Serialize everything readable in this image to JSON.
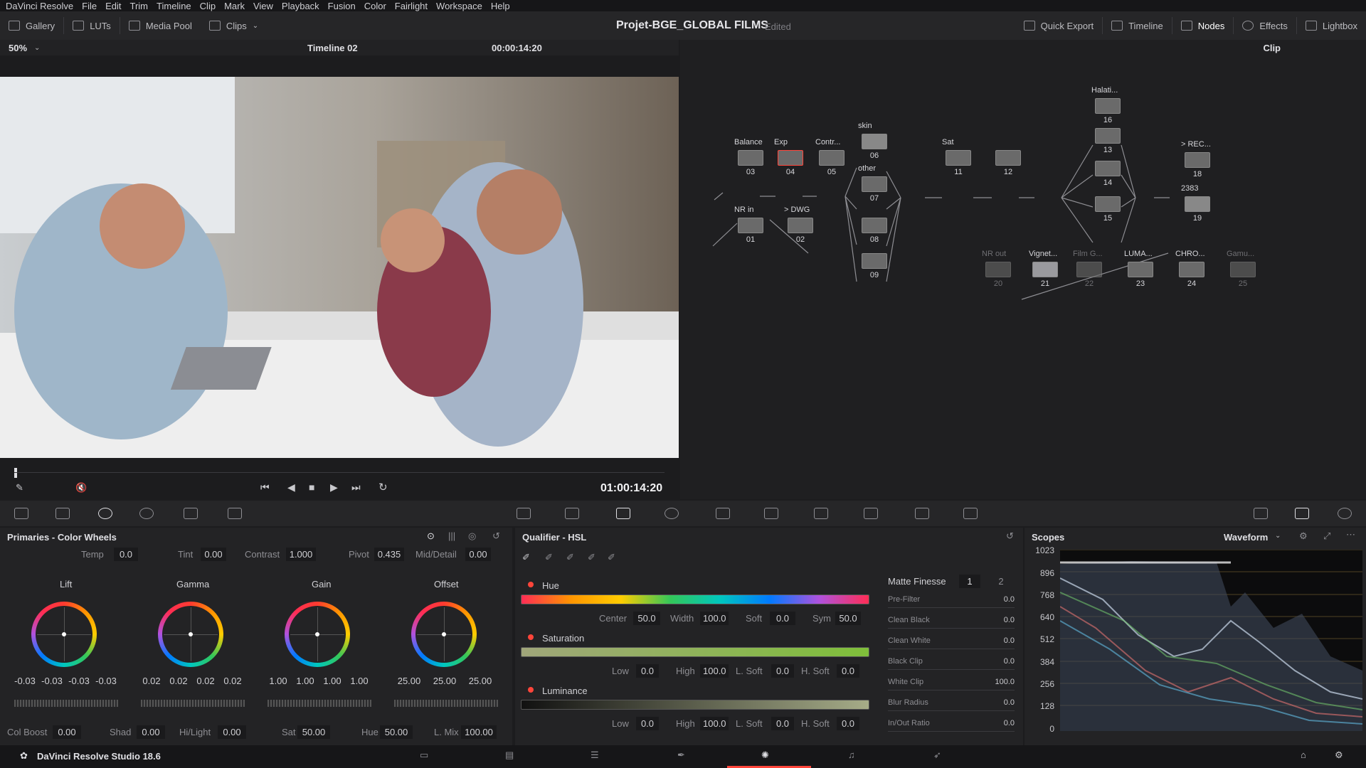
{
  "app": {
    "name": "DaVinci Resolve"
  },
  "menu": [
    "File",
    "Edit",
    "Trim",
    "Timeline",
    "Clip",
    "Mark",
    "View",
    "Playback",
    "Fusion",
    "Color",
    "Fairlight",
    "Workspace",
    "Help"
  ],
  "toolbar": {
    "left": [
      "Gallery",
      "LUTs",
      "Media Pool",
      "Clips"
    ],
    "project": "Projet-BGE_GLOBAL FILMS",
    "project_status": "Edited",
    "right": [
      "Quick Export",
      "Timeline",
      "Nodes",
      "Effects",
      "Lightbox"
    ]
  },
  "viewer": {
    "zoom": "50%",
    "timeline": "Timeline 02",
    "timecode": "00:00:14:20",
    "playhead_timecode": "01:00:14:20"
  },
  "node_editor": {
    "mode": "Clip",
    "nodes": [
      {
        "num": "03",
        "label": "Balance"
      },
      {
        "num": "04",
        "label": "Exp"
      },
      {
        "num": "05",
        "label": "Contr..."
      },
      {
        "num": "06",
        "label": "skin"
      },
      {
        "num": "07",
        "label": "other"
      },
      {
        "num": "08",
        "label": ""
      },
      {
        "num": "09",
        "label": ""
      },
      {
        "num": "11",
        "label": "Sat"
      },
      {
        "num": "12",
        "label": ""
      },
      {
        "num": "16",
        "label": "Halati..."
      },
      {
        "num": "13",
        "label": ""
      },
      {
        "num": "14",
        "label": ""
      },
      {
        "num": "15",
        "label": ""
      },
      {
        "num": "18",
        "label": "> REC..."
      },
      {
        "num": "19",
        "label": "2383"
      },
      {
        "num": "01",
        "label": "NR in"
      },
      {
        "num": "02",
        "label": "> DWG"
      },
      {
        "num": "20",
        "label": "NR out"
      },
      {
        "num": "21",
        "label": "Vignet..."
      },
      {
        "num": "22",
        "label": "Film G..."
      },
      {
        "num": "23",
        "label": "LUMA..."
      },
      {
        "num": "24",
        "label": "CHRO..."
      },
      {
        "num": "25",
        "label": "Gamu..."
      }
    ]
  },
  "primaries": {
    "title": "Primaries - Color Wheels",
    "top": [
      {
        "label": "Temp",
        "value": "0.0"
      },
      {
        "label": "Tint",
        "value": "0.00"
      },
      {
        "label": "Contrast",
        "value": "1.000"
      },
      {
        "label": "Pivot",
        "value": "0.435"
      },
      {
        "label": "Mid/Detail",
        "value": "0.00"
      }
    ],
    "wheels": [
      {
        "name": "Lift",
        "values": [
          "-0.03",
          "-0.03",
          "-0.03",
          "-0.03"
        ]
      },
      {
        "name": "Gamma",
        "values": [
          "0.02",
          "0.02",
          "0.02",
          "0.02"
        ]
      },
      {
        "name": "Gain",
        "values": [
          "1.00",
          "1.00",
          "1.00",
          "1.00"
        ]
      },
      {
        "name": "Offset",
        "values": [
          "25.00",
          "25.00",
          "25.00"
        ]
      }
    ],
    "bottom": [
      {
        "label": "Col Boost",
        "value": "0.00"
      },
      {
        "label": "Shad",
        "value": "0.00"
      },
      {
        "label": "Hi/Light",
        "value": "0.00"
      },
      {
        "label": "Sat",
        "value": "50.00"
      },
      {
        "label": "Hue",
        "value": "50.00"
      },
      {
        "label": "L. Mix",
        "value": "100.00"
      }
    ]
  },
  "qualifier": {
    "title": "Qualifier - HSL",
    "hue": {
      "label": "Hue",
      "center": "50.0",
      "width": "100.0",
      "soft": "0.0",
      "sym": "50.0",
      "l_center": "Center",
      "l_width": "Width",
      "l_soft": "Soft",
      "l_sym": "Sym"
    },
    "saturation": {
      "label": "Saturation",
      "low": "0.0",
      "high": "100.0",
      "lsoft": "0.0",
      "hsoft": "0.0"
    },
    "luminance": {
      "label": "Luminance",
      "low": "0.0",
      "high": "100.0",
      "lsoft": "0.0",
      "hsoft": "0.0"
    },
    "range_labels": {
      "low": "Low",
      "high": "High",
      "lsoft": "L. Soft",
      "hsoft": "H. Soft"
    },
    "matte_finesse": {
      "title": "Matte Finesse",
      "tabs": [
        "1",
        "2"
      ],
      "rows": [
        {
          "label": "Pre-Filter",
          "value": "0.0"
        },
        {
          "label": "Clean Black",
          "value": "0.0"
        },
        {
          "label": "Clean White",
          "value": "0.0"
        },
        {
          "label": "Black Clip",
          "value": "0.0"
        },
        {
          "label": "White Clip",
          "value": "100.0"
        },
        {
          "label": "Blur Radius",
          "value": "0.0"
        },
        {
          "label": "In/Out Ratio",
          "value": "0.0"
        }
      ]
    }
  },
  "scopes": {
    "title": "Scopes",
    "type": "Waveform",
    "y_ticks": [
      "1023",
      "896",
      "768",
      "640",
      "512",
      "384",
      "256",
      "128",
      "0"
    ]
  },
  "footer": {
    "product": "DaVinci Resolve Studio 18.6"
  }
}
